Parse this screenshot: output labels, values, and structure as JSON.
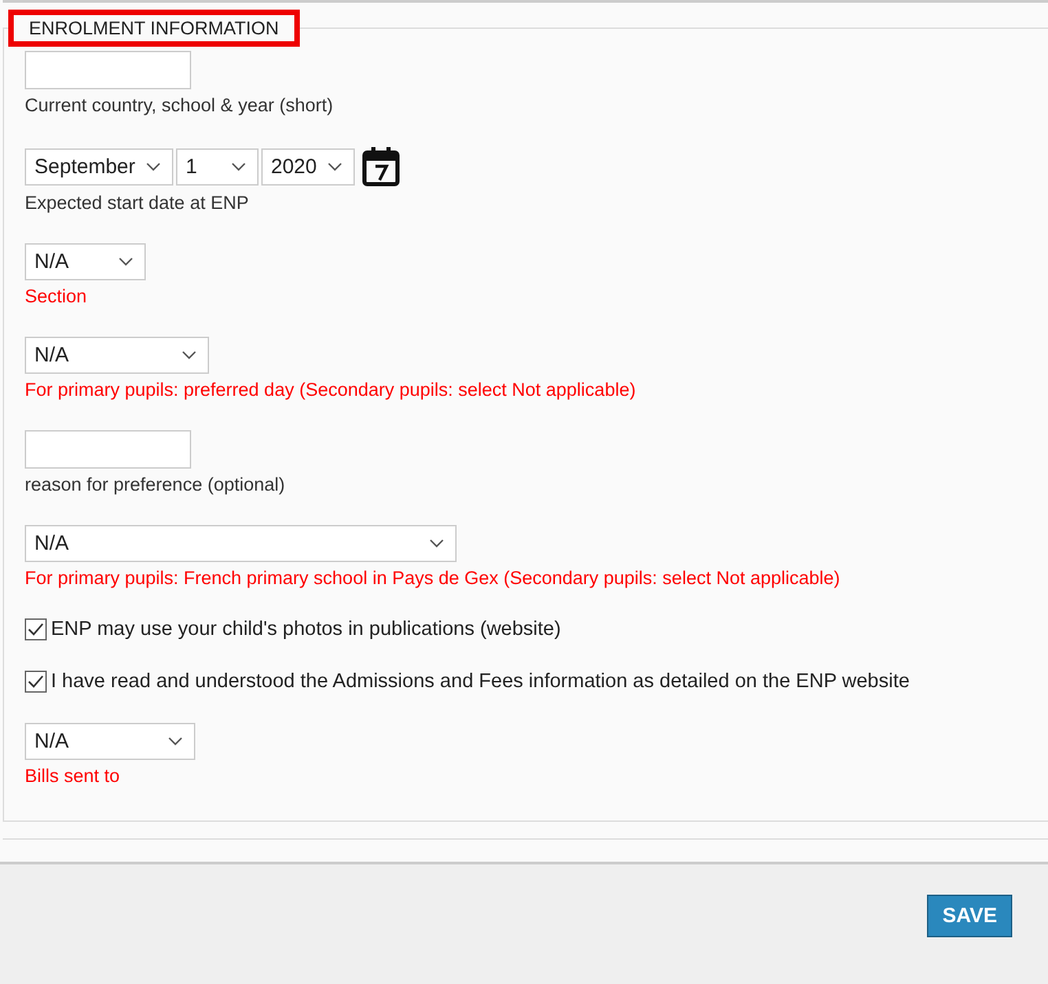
{
  "section": {
    "title": "ENROLMENT INFORMATION",
    "highlighted": true
  },
  "fields": [
    {
      "kind": "text",
      "label": "Current country, school & year (short)",
      "required": false
    },
    {
      "kind": "date",
      "label": "Expected start date at ENP",
      "required": false,
      "parts": [
        "September",
        "1",
        "2020"
      ]
    },
    {
      "kind": "select",
      "value": "N/A",
      "label": "Section",
      "required": true
    },
    {
      "kind": "select",
      "value": "N/A",
      "label": "For primary pupils: preferred day (Secondary pupils: select Not applicable)",
      "required": true
    },
    {
      "kind": "text",
      "label": "reason for preference (optional)",
      "required": false
    },
    {
      "kind": "select",
      "value": "N/A",
      "label": "For primary pupils: French primary school in Pays de Gex (Secondary pupils: select Not applicable)",
      "required": true
    },
    {
      "kind": "checkbox",
      "label": "ENP may use your child's photos in publications (website)",
      "checked": true
    },
    {
      "kind": "checkbox",
      "label": "I have read and understood the Admissions and Fees information as detailed on the ENP website",
      "checked": true
    },
    {
      "kind": "select",
      "value": "N/A",
      "label": "Bills sent to",
      "required": true
    }
  ],
  "save_button": "SAVE"
}
